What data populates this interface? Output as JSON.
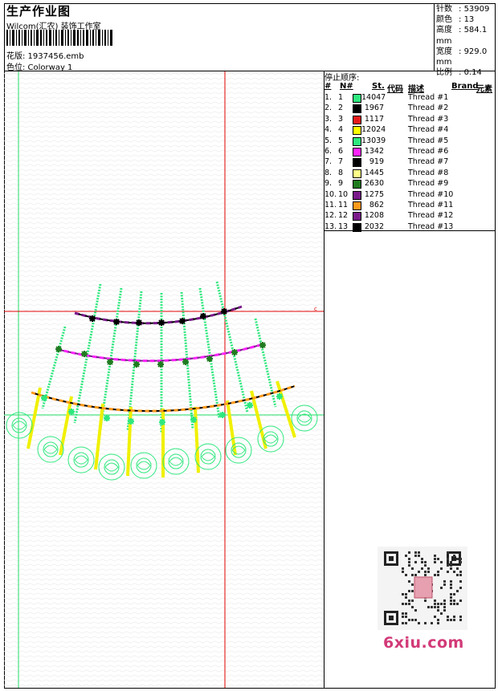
{
  "header": {
    "title": "生产作业图",
    "company": "Wilcom(汇农) 装饰工作室",
    "design_label": "花版: 1937456.emb",
    "colorway_label": "色位: Colorway 1"
  },
  "stats": [
    {
      "label": "针数",
      "value": "53909"
    },
    {
      "label": "颜色",
      "value": "13"
    },
    {
      "label": "高度",
      "value": "584.1 mm"
    },
    {
      "label": "宽度",
      "value": "929.0 mm"
    },
    {
      "label": "比例",
      "value": "0.14"
    }
  ],
  "stop_sequence": {
    "label": "停止顺序:",
    "columns": {
      "hash": "#",
      "no": "N#",
      "st": "St.",
      "code": "代码",
      "desc": "描述",
      "brand": "Brand",
      "element": "元素"
    },
    "rows": [
      {
        "idx": "1.",
        "no": "1",
        "color": "#2ee87e",
        "st": "14047",
        "desc": "Thread #1"
      },
      {
        "idx": "2.",
        "no": "2",
        "color": "#000000",
        "st": "1967",
        "desc": "Thread #2"
      },
      {
        "idx": "3.",
        "no": "3",
        "color": "#e81a1a",
        "st": "1117",
        "desc": "Thread #3"
      },
      {
        "idx": "4.",
        "no": "4",
        "color": "#ffff00",
        "st": "12024",
        "desc": "Thread #4"
      },
      {
        "idx": "5.",
        "no": "5",
        "color": "#2ee87e",
        "st": "13039",
        "desc": "Thread #5"
      },
      {
        "idx": "6.",
        "no": "6",
        "color": "#ff22ff",
        "st": "1342",
        "desc": "Thread #6"
      },
      {
        "idx": "7.",
        "no": "7",
        "color": "#000000",
        "st": "919",
        "desc": "Thread #7"
      },
      {
        "idx": "8.",
        "no": "8",
        "color": "#ffff88",
        "st": "1445",
        "desc": "Thread #8"
      },
      {
        "idx": "9.",
        "no": "9",
        "color": "#1f7a1f",
        "st": "2630",
        "desc": "Thread #9"
      },
      {
        "idx": "10.",
        "no": "10",
        "color": "#7a1a8a",
        "st": "1275",
        "desc": "Thread #10"
      },
      {
        "idx": "11.",
        "no": "11",
        "color": "#ff9a1a",
        "st": "862",
        "desc": "Thread #11"
      },
      {
        "idx": "12.",
        "no": "12",
        "color": "#7a1a8a",
        "st": "1208",
        "desc": "Thread #12"
      },
      {
        "idx": "13.",
        "no": "13",
        "color": "#000000",
        "st": "2032",
        "desc": "Thread #13"
      }
    ]
  },
  "watermark": "6xiu.com",
  "colors": {
    "guide_red": "#e00000",
    "guide_green": "#22dd66",
    "thread_green": "#2ee87e",
    "yellow": "#ffff00"
  }
}
